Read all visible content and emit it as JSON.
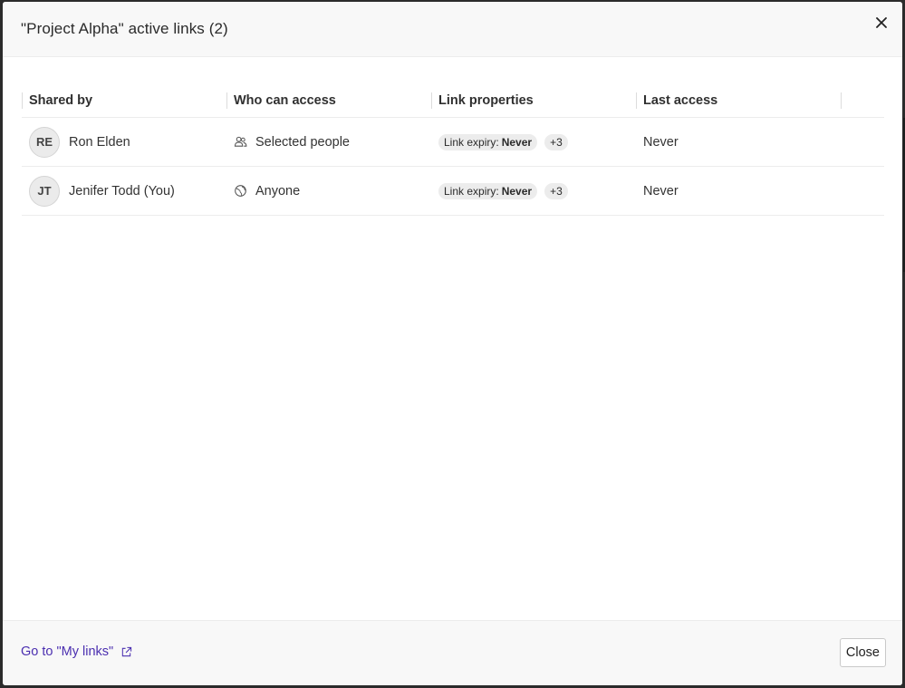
{
  "dialog": {
    "title": "\"Project Alpha\" active links (2)"
  },
  "table": {
    "columns": [
      "Shared by",
      "Who can access",
      "Link properties",
      "Last access"
    ],
    "rows": [
      {
        "initials": "RE",
        "shared_by": "Ron Elden",
        "access_icon": "people-icon",
        "who_can_access": "Selected people",
        "expiry_label": "Link expiry:",
        "expiry_value": "Never",
        "more_count": "+3",
        "last_access": "Never"
      },
      {
        "initials": "JT",
        "shared_by": "Jenifer Todd (You)",
        "access_icon": "globe-icon",
        "who_can_access": "Anyone",
        "expiry_label": "Link expiry:",
        "expiry_value": "Never",
        "more_count": "+3",
        "last_access": "Never"
      }
    ]
  },
  "footer": {
    "my_links_label": "Go to \"My links\"",
    "close_label": "Close"
  },
  "colors": {
    "link": "#4b2fb0",
    "header_bg": "#f8f8f8",
    "chip_bg": "#ececec"
  }
}
